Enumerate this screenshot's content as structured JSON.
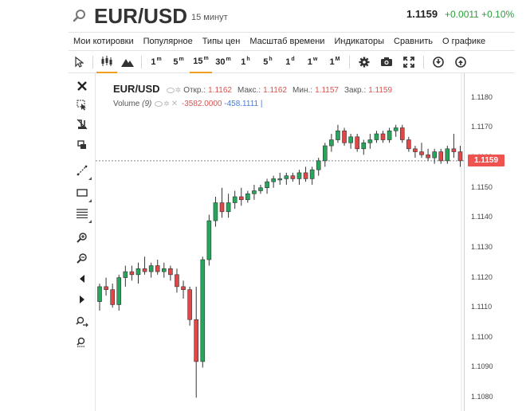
{
  "header": {
    "symbol": "EUR/USD",
    "interval": "15 минут",
    "last_price": "1.1159",
    "change": "+0.0011 +0.10%"
  },
  "menu": [
    "Мои котировки",
    "Популярное",
    "Типы цен",
    "Масштаб времени",
    "Индикаторы",
    "Сравнить",
    "О графике"
  ],
  "toolbar": {
    "timeframes": [
      {
        "num": "1",
        "unit": "m",
        "name": "tf-1m"
      },
      {
        "num": "5",
        "unit": "m",
        "name": "tf-5m"
      },
      {
        "num": "15",
        "unit": "m",
        "name": "tf-15m"
      },
      {
        "num": "30",
        "unit": "m",
        "name": "tf-30m"
      },
      {
        "num": "1",
        "unit": "h",
        "name": "tf-1h"
      },
      {
        "num": "5",
        "unit": "h",
        "name": "tf-5h"
      },
      {
        "num": "1",
        "unit": "d",
        "name": "tf-1d"
      },
      {
        "num": "1",
        "unit": "w",
        "name": "tf-1w"
      },
      {
        "num": "1",
        "unit": "M",
        "name": "tf-1M"
      }
    ],
    "active_timeframe": "tf-15m"
  },
  "legend": {
    "symbol": "EUR/USD",
    "open_label": "Откр.:",
    "open": "1.1162",
    "high_label": "Макс.:",
    "high": "1.1162",
    "low_label": "Мин.:",
    "low": "1.1157",
    "close_label": "Закр.:",
    "close": "1.1159",
    "volume_label": "Volume",
    "volume_period": "(9)",
    "volume_value1": "-3582.0000",
    "volume_value2": "-458.1111"
  },
  "colors": {
    "up": "#26a65b",
    "down": "#e04848",
    "accent": "#f0a020",
    "price_tag": "#ef5350"
  },
  "chart_data": {
    "type": "candlestick",
    "y_ticks": [
      "1.1180",
      "1.1170",
      "1.1160",
      "1.1150",
      "1.1140",
      "1.1130",
      "1.1120",
      "1.1110",
      "1.1100",
      "1.1090",
      "1.1080"
    ],
    "ylim": [
      1.10755,
      1.11882
    ],
    "current_price": 1.1159,
    "current_price_label": "1.1159",
    "candles": [
      {
        "o": 1.1112,
        "h": 1.1118,
        "l": 1.1109,
        "c": 1.1117
      },
      {
        "o": 1.1117,
        "h": 1.112,
        "l": 1.1114,
        "c": 1.1116
      },
      {
        "o": 1.1116,
        "h": 1.1118,
        "l": 1.111,
        "c": 1.1111
      },
      {
        "o": 1.1111,
        "h": 1.1121,
        "l": 1.1109,
        "c": 1.112
      },
      {
        "o": 1.112,
        "h": 1.1124,
        "l": 1.1117,
        "c": 1.1122
      },
      {
        "o": 1.1122,
        "h": 1.1124,
        "l": 1.1119,
        "c": 1.1121
      },
      {
        "o": 1.1121,
        "h": 1.1125,
        "l": 1.1118,
        "c": 1.1123
      },
      {
        "o": 1.1123,
        "h": 1.1127,
        "l": 1.1121,
        "c": 1.1122
      },
      {
        "o": 1.1122,
        "h": 1.1125,
        "l": 1.112,
        "c": 1.1124
      },
      {
        "o": 1.1124,
        "h": 1.1126,
        "l": 1.1121,
        "c": 1.1122
      },
      {
        "o": 1.1122,
        "h": 1.1125,
        "l": 1.112,
        "c": 1.1123
      },
      {
        "o": 1.1123,
        "h": 1.1124,
        "l": 1.1119,
        "c": 1.1121
      },
      {
        "o": 1.1121,
        "h": 1.1123,
        "l": 1.1115,
        "c": 1.1117
      },
      {
        "o": 1.1117,
        "h": 1.1119,
        "l": 1.1113,
        "c": 1.1116
      },
      {
        "o": 1.1116,
        "h": 1.1117,
        "l": 1.1104,
        "c": 1.1106
      },
      {
        "o": 1.1106,
        "h": 1.1117,
        "l": 1.108,
        "c": 1.1092
      },
      {
        "o": 1.1092,
        "h": 1.1127,
        "l": 1.109,
        "c": 1.1126
      },
      {
        "o": 1.1126,
        "h": 1.1141,
        "l": 1.1124,
        "c": 1.1139
      },
      {
        "o": 1.1139,
        "h": 1.1147,
        "l": 1.1137,
        "c": 1.1145
      },
      {
        "o": 1.1145,
        "h": 1.115,
        "l": 1.114,
        "c": 1.1142
      },
      {
        "o": 1.1142,
        "h": 1.1148,
        "l": 1.114,
        "c": 1.1145
      },
      {
        "o": 1.1145,
        "h": 1.1149,
        "l": 1.1143,
        "c": 1.1147
      },
      {
        "o": 1.1147,
        "h": 1.115,
        "l": 1.1144,
        "c": 1.1146
      },
      {
        "o": 1.1146,
        "h": 1.1149,
        "l": 1.1145,
        "c": 1.1148
      },
      {
        "o": 1.1148,
        "h": 1.1151,
        "l": 1.1146,
        "c": 1.1149
      },
      {
        "o": 1.1149,
        "h": 1.1151,
        "l": 1.1148,
        "c": 1.115
      },
      {
        "o": 1.115,
        "h": 1.1153,
        "l": 1.1148,
        "c": 1.1152
      },
      {
        "o": 1.1152,
        "h": 1.1154,
        "l": 1.115,
        "c": 1.1153
      },
      {
        "o": 1.1153,
        "h": 1.1155,
        "l": 1.1151,
        "c": 1.1153
      },
      {
        "o": 1.1153,
        "h": 1.1155,
        "l": 1.1151,
        "c": 1.1154
      },
      {
        "o": 1.1154,
        "h": 1.1155,
        "l": 1.1152,
        "c": 1.1153
      },
      {
        "o": 1.1153,
        "h": 1.1156,
        "l": 1.1151,
        "c": 1.1155
      },
      {
        "o": 1.1155,
        "h": 1.1157,
        "l": 1.1152,
        "c": 1.1153
      },
      {
        "o": 1.1153,
        "h": 1.1157,
        "l": 1.1151,
        "c": 1.1156
      },
      {
        "o": 1.1156,
        "h": 1.116,
        "l": 1.1154,
        "c": 1.1159
      },
      {
        "o": 1.1159,
        "h": 1.1165,
        "l": 1.1157,
        "c": 1.1164
      },
      {
        "o": 1.1164,
        "h": 1.1168,
        "l": 1.1162,
        "c": 1.1166
      },
      {
        "o": 1.1166,
        "h": 1.1171,
        "l": 1.1165,
        "c": 1.1169
      },
      {
        "o": 1.1169,
        "h": 1.117,
        "l": 1.1164,
        "c": 1.1165
      },
      {
        "o": 1.1165,
        "h": 1.1168,
        "l": 1.1163,
        "c": 1.1167
      },
      {
        "o": 1.1167,
        "h": 1.1168,
        "l": 1.1162,
        "c": 1.1163
      },
      {
        "o": 1.1163,
        "h": 1.1166,
        "l": 1.1161,
        "c": 1.1165
      },
      {
        "o": 1.1165,
        "h": 1.1168,
        "l": 1.1163,
        "c": 1.1166
      },
      {
        "o": 1.1166,
        "h": 1.1169,
        "l": 1.1165,
        "c": 1.1168
      },
      {
        "o": 1.1168,
        "h": 1.1169,
        "l": 1.1165,
        "c": 1.1166
      },
      {
        "o": 1.1166,
        "h": 1.117,
        "l": 1.1165,
        "c": 1.1169
      },
      {
        "o": 1.1169,
        "h": 1.1171,
        "l": 1.1167,
        "c": 1.117
      },
      {
        "o": 1.117,
        "h": 1.1171,
        "l": 1.1165,
        "c": 1.1166
      },
      {
        "o": 1.1166,
        "h": 1.1167,
        "l": 1.1162,
        "c": 1.1163
      },
      {
        "o": 1.1163,
        "h": 1.1164,
        "l": 1.116,
        "c": 1.1162
      },
      {
        "o": 1.1162,
        "h": 1.1165,
        "l": 1.116,
        "c": 1.1161
      },
      {
        "o": 1.1161,
        "h": 1.1163,
        "l": 1.1159,
        "c": 1.116
      },
      {
        "o": 1.116,
        "h": 1.1163,
        "l": 1.1158,
        "c": 1.1162
      },
      {
        "o": 1.1162,
        "h": 1.1163,
        "l": 1.1158,
        "c": 1.1159
      },
      {
        "o": 1.1159,
        "h": 1.1164,
        "l": 1.1158,
        "c": 1.1163
      },
      {
        "o": 1.1163,
        "h": 1.1168,
        "l": 1.116,
        "c": 1.1162
      },
      {
        "o": 1.1162,
        "h": 1.1164,
        "l": 1.1157,
        "c": 1.1159
      }
    ]
  }
}
